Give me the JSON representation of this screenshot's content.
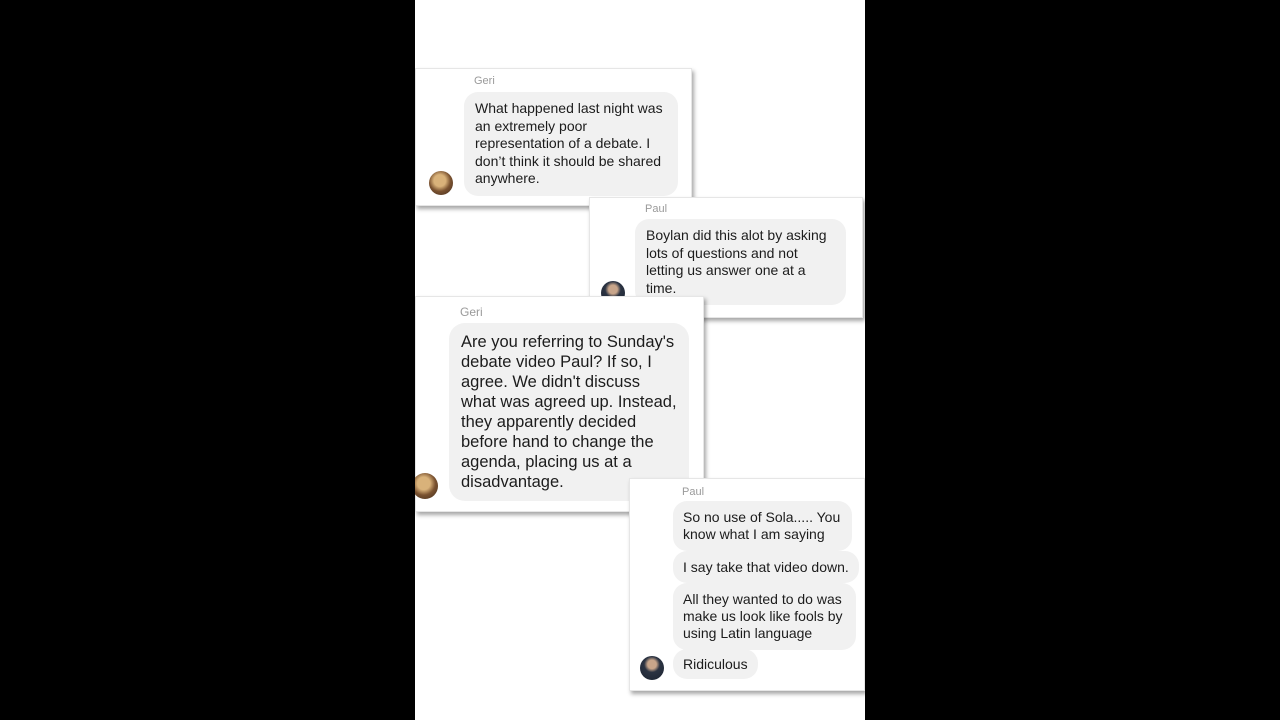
{
  "messages": [
    {
      "sender": "Geri",
      "bubbles": [
        "What happened last night was an extremely poor representation of a debate. I don’t think it should be shared anywhere."
      ]
    },
    {
      "sender": "Paul",
      "bubbles": [
        "Boylan did this alot by asking lots of questions and not letting us answer one at a time."
      ]
    },
    {
      "sender": "Geri",
      "bubbles": [
        "Are you referring to Sunday's debate video Paul?  If so, I agree.  We didn't discuss what was agreed up. Instead, they apparently decided before hand to change the agenda, placing us at a disadvantage."
      ]
    },
    {
      "sender": "Paul",
      "bubbles": [
        "So no use of Sola.....  You know what I am saying",
        "I say take that video down.",
        "All they wanted to do was make us look like fools by using Latin language",
        "Ridiculous"
      ]
    }
  ],
  "icons": {
    "geri_avatar": "geri-avatar",
    "paul_avatar": "paul-avatar"
  }
}
